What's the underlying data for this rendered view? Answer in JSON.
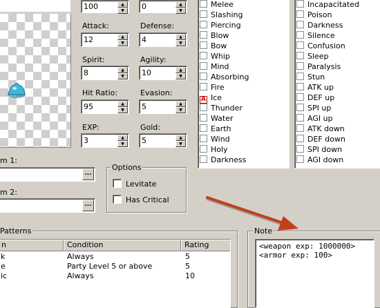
{
  "stats": {
    "top_left_value": "100",
    "top_right_value": "0",
    "attack_label": "Attack:",
    "attack_value": "12",
    "defense_label": "Defense:",
    "defense_value": "4",
    "spirit_label": "Spirit:",
    "spirit_value": "8",
    "agility_label": "Agility:",
    "agility_value": "10",
    "hit_ratio_label": "Hit Ratio:",
    "hit_ratio_value": "95",
    "evasion_label": "Evasion:",
    "evasion_value": "5",
    "exp_label": "EXP:",
    "exp_value": "3",
    "gold_label": "Gold:",
    "gold_value": "5"
  },
  "drops": {
    "item1_label": "m 1:",
    "item2_label": "m 2:",
    "browse_label": "..."
  },
  "options": {
    "title": "Options",
    "levitate_label": "Levitate",
    "has_critical_label": "Has Critical"
  },
  "elements": {
    "items": [
      {
        "label": "Melee",
        "rank": ""
      },
      {
        "label": "Slashing",
        "rank": ""
      },
      {
        "label": "Piercing",
        "rank": ""
      },
      {
        "label": "Blow",
        "rank": ""
      },
      {
        "label": "Bow",
        "rank": ""
      },
      {
        "label": "Whip",
        "rank": ""
      },
      {
        "label": "Mind",
        "rank": ""
      },
      {
        "label": "Absorbing",
        "rank": ""
      },
      {
        "label": "Fire",
        "rank": ""
      },
      {
        "label": "Ice",
        "rank": "A"
      },
      {
        "label": "Thunder",
        "rank": ""
      },
      {
        "label": "Water",
        "rank": ""
      },
      {
        "label": "Earth",
        "rank": ""
      },
      {
        "label": "Wind",
        "rank": ""
      },
      {
        "label": "Holy",
        "rank": ""
      },
      {
        "label": "Darkness",
        "rank": ""
      }
    ]
  },
  "states": {
    "items": [
      {
        "label": "Incapacitated"
      },
      {
        "label": "Poison"
      },
      {
        "label": "Darkness"
      },
      {
        "label": "Silence"
      },
      {
        "label": "Confusion"
      },
      {
        "label": "Sleep"
      },
      {
        "label": "Paralysis"
      },
      {
        "label": "Stun"
      },
      {
        "label": "ATK up"
      },
      {
        "label": "DEF up"
      },
      {
        "label": "SPI up"
      },
      {
        "label": "AGI up"
      },
      {
        "label": "ATK down"
      },
      {
        "label": "DEF down"
      },
      {
        "label": "SPI down"
      },
      {
        "label": "AGI down"
      }
    ]
  },
  "patterns": {
    "title": "Patterns",
    "columns": [
      "n",
      "Condition",
      "Rating"
    ],
    "rows": [
      {
        "action": "k",
        "condition": "Always",
        "rating": "5"
      },
      {
        "action": "e",
        "condition": "Party Level 5 or above",
        "rating": "5"
      },
      {
        "action": "ic",
        "condition": "Always",
        "rating": "10"
      }
    ]
  },
  "note": {
    "title": "Note",
    "lines": [
      "<weapon exp: 1000000>",
      "<armor exp: 100>"
    ]
  },
  "colors": {
    "window_bg": "#d4d0c8",
    "arrow": "#c0401a",
    "slime": "#3fb8d8"
  }
}
